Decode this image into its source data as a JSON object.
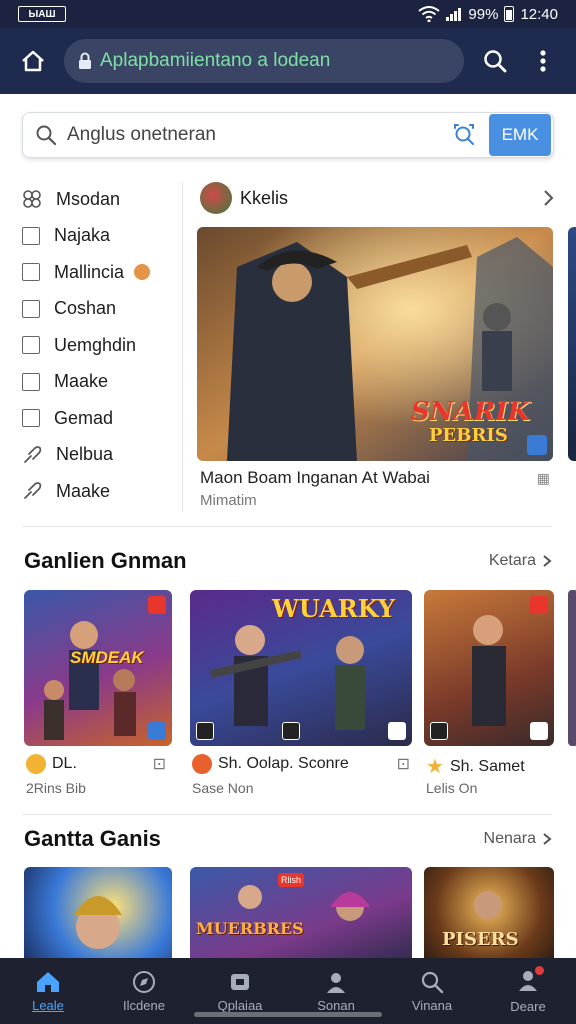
{
  "status_bar": {
    "carrier_logo": "ЫАШ",
    "battery": "99%",
    "time": "12:40"
  },
  "browser": {
    "url": "Aplapbamiientano a lodean"
  },
  "search": {
    "placeholder": "Anglus onetneran",
    "button_label": "EMK"
  },
  "menu": {
    "items": [
      {
        "label": "Msodan",
        "icon": "category-icon"
      },
      {
        "label": "Najaka",
        "icon": "checkbox"
      },
      {
        "label": "Mallincia",
        "icon": "checkbox",
        "badge": true
      },
      {
        "label": "Coshan",
        "icon": "checkbox"
      },
      {
        "label": "Uemghdin",
        "icon": "checkbox"
      },
      {
        "label": "Maake",
        "icon": "checkbox"
      },
      {
        "label": "Gemad",
        "icon": "checkbox"
      },
      {
        "label": "Nelbua",
        "icon": "link-icon"
      },
      {
        "label": "Maake",
        "icon": "link-icon"
      }
    ]
  },
  "featured": {
    "channel": "Kkelis",
    "image_text_line1": "SNARIK",
    "image_text_line2": "PEBRIS",
    "title": "Maon Boam Inganan At Wabai",
    "subtitle": "Mimatim"
  },
  "section1": {
    "title": "Ganlien Gnman",
    "more": "Ketara",
    "cards": [
      {
        "art_text": "SMDEAK",
        "meta": "DL.",
        "sub": "2Rins Bib",
        "meta_icon_color": "#f2b233"
      },
      {
        "art_text": "WUARKY",
        "meta": "Sh. Oolap. Sconre",
        "sub": "Sase Non",
        "meta_icon_color": "#e8602c"
      },
      {
        "art_text": "",
        "meta": "Sh. Samet",
        "sub": "Lelis On",
        "meta_icon_color": "#f2b233"
      }
    ]
  },
  "section2": {
    "title": "Gantta Ganis",
    "more": "Nenara",
    "cards": [
      {
        "art_text": ""
      },
      {
        "art_text": "MUERBRES",
        "art_badge": "Rlish"
      },
      {
        "art_text": "PISERS"
      }
    ]
  },
  "bottom_nav": {
    "items": [
      {
        "label": "Leale",
        "active": true
      },
      {
        "label": "Ilcdene"
      },
      {
        "label": "Qplaiaa"
      },
      {
        "label": "Sonan"
      },
      {
        "label": "Vinana"
      },
      {
        "label": "Deare"
      }
    ]
  },
  "colors": {
    "accent": "#4a90e2",
    "header_bg": "#1e2a4e",
    "nav_bg": "#1e2230",
    "active_nav": "#4aa3ff"
  }
}
